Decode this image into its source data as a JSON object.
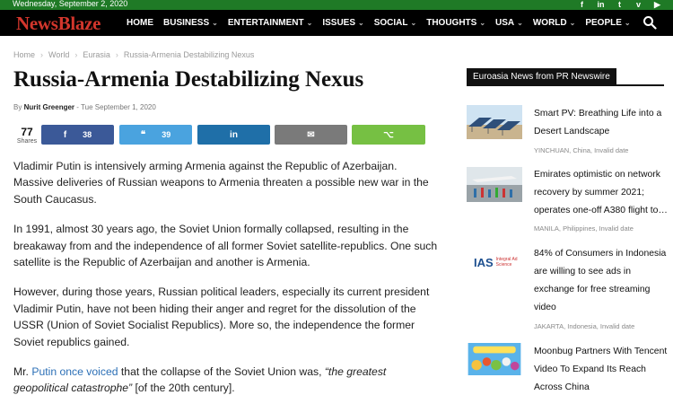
{
  "topbar": {
    "date": "Wednesday, September 2, 2020",
    "socials": [
      "facebook-icon",
      "linkedin-icon",
      "twitter-icon",
      "vimeo-icon",
      "youtube-icon"
    ]
  },
  "nav": {
    "logo": "NewsBlaze",
    "items": [
      {
        "label": "HOME",
        "dropdown": false
      },
      {
        "label": "BUSINESS",
        "dropdown": true
      },
      {
        "label": "ENTERTAINMENT",
        "dropdown": true
      },
      {
        "label": "ISSUES",
        "dropdown": true
      },
      {
        "label": "SOCIAL",
        "dropdown": true
      },
      {
        "label": "THOUGHTS",
        "dropdown": true
      },
      {
        "label": "USA",
        "dropdown": true
      },
      {
        "label": "WORLD",
        "dropdown": true
      },
      {
        "label": "PEOPLE",
        "dropdown": true
      }
    ]
  },
  "breadcrumb": [
    "Home",
    "World",
    "Eurasia",
    "Russia-Armenia Destabilizing Nexus"
  ],
  "article": {
    "title": "Russia-Armenia Destabilizing Nexus",
    "by": "By",
    "author": "Nurit Greenger",
    "sep": "-",
    "date": "Tue September 1, 2020",
    "share_total": "77",
    "share_label": "Shares",
    "share_buttons": [
      {
        "icon": "facebook-icon",
        "glyph": "f",
        "count": "38",
        "color": "#3b5998"
      },
      {
        "icon": "twitter-icon",
        "glyph": "❝",
        "count": "39",
        "color": "#4aa3df"
      },
      {
        "icon": "linkedin-icon",
        "glyph": "in",
        "count": "",
        "color": "#1f6fa8"
      },
      {
        "icon": "email-icon",
        "glyph": "✉",
        "count": "",
        "color": "#7a7a7a"
      },
      {
        "icon": "share-icon",
        "glyph": "⌥",
        "count": "",
        "color": "#76c043"
      }
    ],
    "paragraphs": [
      "Vladimir Putin is intensively arming Armenia against the Republic of Azerbaijan. Massive deliveries of Russian weapons to Armenia threaten a possible new war in the South Caucasus.",
      "In 1991, almost 30 years ago, the Soviet Union formally collapsed, resulting in the breakaway from and the independence of all former Soviet satellite-republics. One such satellite is the Republic of Azerbaijan and another is Armenia.",
      "However, during those years, Russian political leaders, especially its current president Vladimir Putin, have not been hiding their anger and regret for the dissolution of the USSR (Union of Soviet Socialist Republics). More so, the independence the former Soviet republics gained."
    ],
    "last_para": {
      "pre": "Mr. ",
      "link": "Putin once voiced",
      "mid": " that the collapse of the Soviet Union was, ",
      "quote": "“the greatest geopolitical catastrophe”",
      "post": " [of the 20th century]."
    }
  },
  "sidebar": {
    "heading": "Euroasia News from PR Newswire",
    "items": [
      {
        "title": "Smart PV: Breathing Life into a Desert Landscape",
        "meta": "YINCHUAN, China, Invalid date"
      },
      {
        "title": "Emirates optimistic on network recovery by summer 2021; operates one-off A380 flight to…",
        "meta": "MANILA, Philippines, Invalid date"
      },
      {
        "title": "84% of Consumers in Indonesia are willing to see ads in exchange for free streaming video",
        "meta": "JAKARTA, Indonesia, Invalid date",
        "logo": "IAS",
        "logo_sub": "Integral Ad Science"
      },
      {
        "title": "Moonbug Partners With Tencent Video To Expand Its Reach Across China",
        "meta": ""
      }
    ]
  }
}
